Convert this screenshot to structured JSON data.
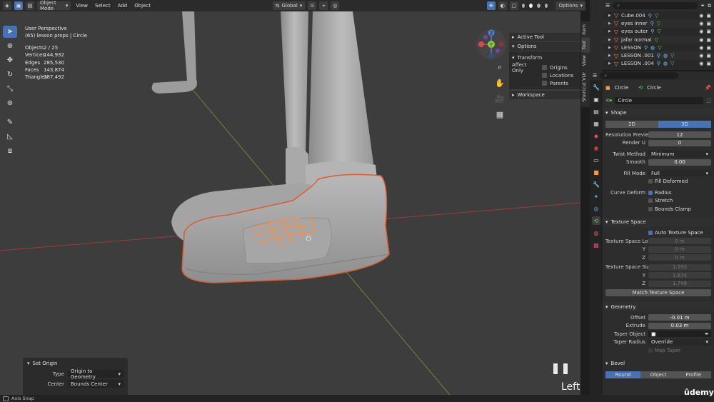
{
  "header": {
    "mode": "Object Mode",
    "menus": [
      "View",
      "Select",
      "Add",
      "Object"
    ],
    "orientation": "Global",
    "options": "Options"
  },
  "overlay": {
    "line1": "User Perspective",
    "line2": "(65) lesson props | Circle"
  },
  "stats": [
    {
      "label": "Objects",
      "value": "2 / 25"
    },
    {
      "label": "Vertices",
      "value": "144,932"
    },
    {
      "label": "Edges",
      "value": "285,530"
    },
    {
      "label": "Faces",
      "value": "143,874"
    },
    {
      "label": "Triangles",
      "value": "287,492"
    }
  ],
  "gizmo": {
    "x": "X",
    "y": "Y",
    "z": "Z"
  },
  "npanel": {
    "active_tool": "Active Tool",
    "options": "Options",
    "transform": "Transform",
    "affect_only": "Affect Only",
    "origins": "Origins",
    "locations": "Locations",
    "parents": "Parents",
    "workspace": "Workspace",
    "tabs": [
      "Item",
      "Tool",
      "View",
      "Shortcut VUr"
    ]
  },
  "last_op": {
    "title": "Set Origin",
    "type_label": "Type",
    "type_value": "Origin to Geometry",
    "center_label": "Center",
    "center_value": "Bounds Center"
  },
  "view_name": "Left",
  "status": {
    "text": "Axis Snap"
  },
  "outliner": {
    "rows": [
      "Cube.004",
      "eyes inner",
      "eyes outer",
      "jafar normal",
      "LESSON",
      "LESSON .001",
      "LESSON .004"
    ]
  },
  "properties": {
    "path_obj": "Circle",
    "path_data": "Circle",
    "datablock": "Circle",
    "shape": {
      "title": "Shape",
      "opt_2d": "2D",
      "opt_3d": "3D",
      "res_preview_label": "Resolution Preview...",
      "res_preview_value": "12",
      "render_u_label": "Render U",
      "render_u_value": "0",
      "twist_label": "Twist Method",
      "twist_value": "Minimum",
      "smooth_label": "Smooth",
      "smooth_value": "0.00",
      "fill_mode_label": "Fill Mode",
      "fill_mode_value": "Full",
      "fill_deformed": "Fill Deformed",
      "curve_deform_label": "Curve Deform",
      "radius": "Radius",
      "stretch": "Stretch",
      "bounds_clamp": "Bounds Clamp"
    },
    "texture_space": {
      "title": "Texture Space",
      "auto": "Auto Texture Space",
      "loc_label": "Texture Space Loc...",
      "loc_x": "0 m",
      "y_label": "Y",
      "loc_y": "0 m",
      "z_label": "Z",
      "loc_z": "0 m",
      "size_label": "Texture Space Size",
      "size_x": "1.593",
      "size_y": "1.674",
      "size_z": "1.749",
      "match_btn": "Match Texture Space"
    },
    "geometry": {
      "title": "Geometry",
      "offset_label": "Offset",
      "offset_value": "-0.01 m",
      "extrude_label": "Extrude",
      "extrude_value": "0.03 m",
      "taper_obj_label": "Taper Object",
      "taper_radius_label": "Taper Radius",
      "taper_radius_value": "Override",
      "map_taper": "Map Taper"
    },
    "bevel": {
      "title": "Bevel",
      "round": "Round",
      "object": "Object",
      "profile": "Profile"
    }
  },
  "watermark": "ûdemy"
}
